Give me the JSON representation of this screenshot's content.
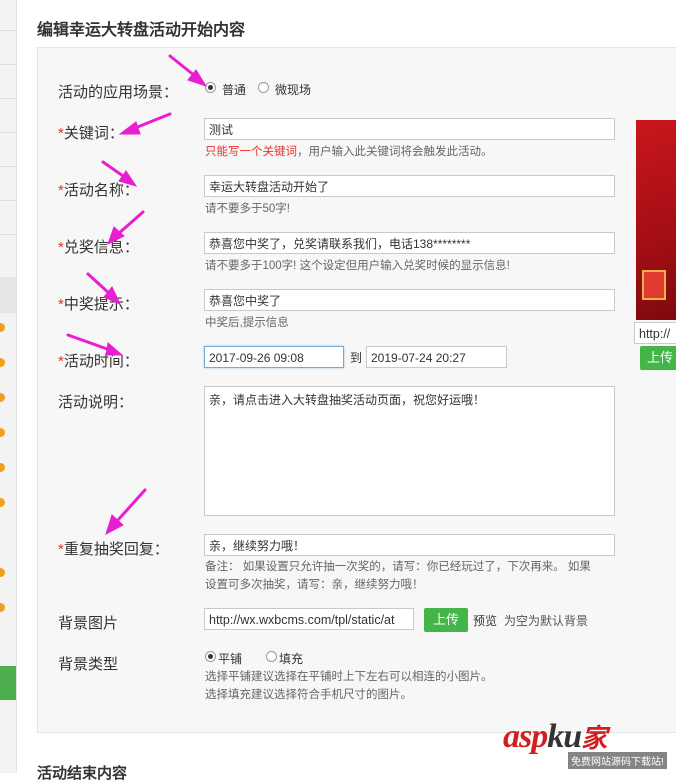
{
  "section_title": "编辑幸运大转盘活动开始内容",
  "scene": {
    "label": "活动的应用场景：",
    "options": [
      "普通",
      "微现场"
    ],
    "selected": "普通"
  },
  "keyword": {
    "required_mark": "*",
    "label": "关键词：",
    "value": "测试",
    "hint_red": "只能写一个关键词",
    "hint_rest": "，用户输入此关键词将会触发此活动。"
  },
  "activity_name": {
    "required_mark": "*",
    "label": "活动名称：",
    "value": "幸运大转盘活动开始了",
    "hint": "请不要多于50字!"
  },
  "prize_info": {
    "required_mark": "*",
    "label": "兑奖信息：",
    "value": "恭喜您中奖了，兑奖请联系我们，电话138********",
    "hint": "请不要多于100字! 这个设定但用户输入兑奖时候的显示信息!"
  },
  "win_tip": {
    "required_mark": "*",
    "label": "中奖提示：",
    "value": "恭喜您中奖了",
    "hint": "中奖后,提示信息"
  },
  "activity_time": {
    "required_mark": "*",
    "label": "活动时间：",
    "start": "2017-09-26 09:08",
    "separator": "到",
    "end": "2019-07-24 20:27"
  },
  "description": {
    "label": "活动说明：",
    "value": "亲，请点击进入大转盘抽奖活动页面，祝您好运哦！"
  },
  "repeat_reply": {
    "required_mark": "*",
    "label": "重复抽奖回复：",
    "value": "亲，继续努力哦！",
    "hint_line1": "备注： 如果设置只允许抽一次奖的，请写：你已经玩过了，下次再来。 如果",
    "hint_line2": "设置可多次抽奖，请写：亲，继续努力哦！"
  },
  "bg_image": {
    "label": "背景图片",
    "value": "http://wx.wxbcms.com/tpl/static/at",
    "upload_label": "上传",
    "preview_label": "预览",
    "empty_hint": "为空为默认背景"
  },
  "bg_type": {
    "label": "背景类型",
    "options": [
      "平铺",
      "填充"
    ],
    "selected": "平铺",
    "hint_line1": "选择平铺建议选择在平铺时上下左右可以相连的小图片。",
    "hint_line2": "选择填充建议选择符合手机尺寸的图片。"
  },
  "side_preview": {
    "url_value": "http://",
    "upload_label": "上传"
  },
  "next_section_title": "活动结束内容",
  "watermark": {
    "brand": "asp",
    "brand_tail": "ku",
    "brand_cn": "家",
    "sub": "免费网站源码下载站!"
  },
  "colors": {
    "accent_green": "#44b549",
    "required_red": "#e8322a",
    "arrow_magenta": "#e81fd0"
  }
}
